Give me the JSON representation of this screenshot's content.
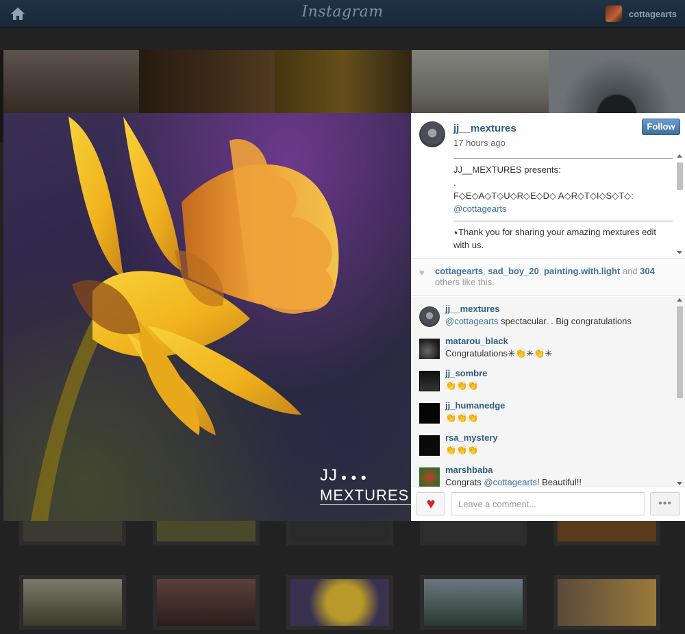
{
  "header": {
    "logo": "Instagram",
    "username": "cottagearts"
  },
  "post": {
    "author": "jj__mextures",
    "time": "17 hours ago",
    "follow_label": "Follow",
    "watermark_top": "JJ",
    "watermark_bottom": "MEXTURES",
    "caption": {
      "line1": "JJ__MEXTURES presents:",
      "line2": ".",
      "line3": "F◇E◇A◇T◇U◇R◇E◇D◇ A◇R◇T◇I◇S◇T◇:",
      "mention": "@cottagearts",
      "line4": "⭑Thank you for sharing your amazing mextures edit with us."
    },
    "likes": {
      "user1": "cottagearts",
      "user2": "sad_boy_20",
      "user3": "painting.with.light",
      "and": "and",
      "count": "304",
      "suffix": "others like this."
    },
    "comments": [
      {
        "user": "jj__mextures",
        "mention": "@cottagearts",
        "text": " spectacular. . Big congratulations"
      },
      {
        "user": "matarou_black",
        "mention": "",
        "text": "Congratulations✳👏✳👏✳"
      },
      {
        "user": "jj_sombre",
        "mention": "",
        "text": "👏👏👏"
      },
      {
        "user": "jj_humanedge",
        "mention": "",
        "text": "👏👏👏"
      },
      {
        "user": "rsa_mystery",
        "mention": "",
        "text": "👏👏👏"
      },
      {
        "user": "marshbaba",
        "mention": "@cottagearts",
        "prefix": "Congrats ",
        "text": "! Beautiful!!"
      }
    ],
    "comment_placeholder": "Leave a comment...",
    "more_label": "•••"
  },
  "icons": {
    "home": "home-icon",
    "heart": "heart-icon",
    "like": "like-heart-icon"
  },
  "colors": {
    "link": "#3f729b",
    "follow": "#4a7bb0",
    "like": "#d6202a"
  }
}
